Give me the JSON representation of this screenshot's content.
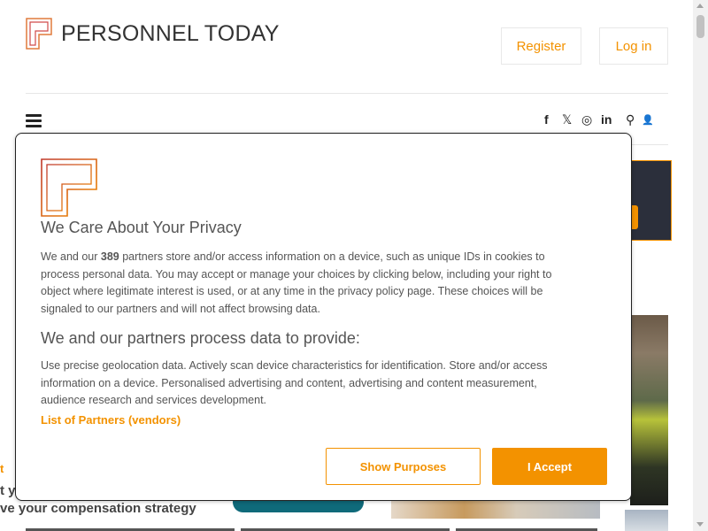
{
  "site": {
    "name": "PERSONNEL TODAY",
    "register_label": "Register",
    "login_label": "Log in"
  },
  "nav": {
    "social": [
      {
        "icon": "facebook-icon",
        "glyph": "f"
      },
      {
        "icon": "x-twitter-icon",
        "glyph": "𝕏"
      },
      {
        "icon": "instagram-icon",
        "glyph": "◎"
      },
      {
        "icon": "linkedin-icon",
        "glyph": "in"
      }
    ],
    "search_glyph": "⚲",
    "user_glyph": "👤"
  },
  "background": {
    "promo_fragment": "t",
    "promo_line2": "t y",
    "promo_line3": "ve your compensation strategy"
  },
  "consent": {
    "title": "We Care About Your Privacy",
    "intro_before": "We and our ",
    "partner_count": "389",
    "intro_after": " partners store and/or access information on a device, such as unique IDs in cookies to process personal data. You may accept or manage your choices by clicking below, including your right to object where legitimate interest is used, or at any time in the privacy policy page. These choices will be signaled to our partners and will not affect browsing data.",
    "purposes_heading": "We and our partners process data to provide:",
    "purposes_text": "Use precise geolocation data. Actively scan device characteristics for identification. Store and/or access information on a device. Personalised advertising and content, advertising and content measurement, audience research and services development.",
    "vendors_link": "List of Partners (vendors)",
    "show_purposes_label": "Show Purposes",
    "accept_label": "I Accept"
  },
  "colors": {
    "accent": "#f39200",
    "text": "#555555"
  }
}
